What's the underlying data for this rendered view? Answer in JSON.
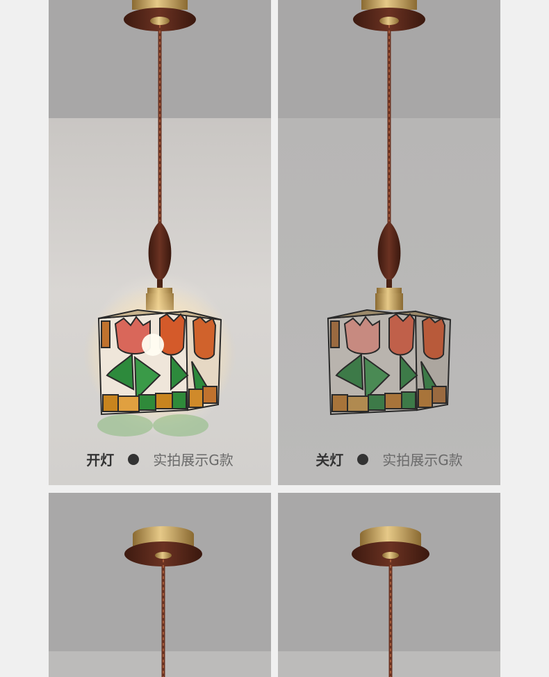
{
  "panels": [
    {
      "state_label": "开灯",
      "product_label": "实拍展示G款"
    },
    {
      "state_label": "关灯",
      "product_label": "实拍展示G款"
    }
  ],
  "icons": [
    "bullet-dot-icon"
  ],
  "colors": {
    "walnut": "#5a2b1c",
    "brass": "#c8a25a",
    "tulip_red": "#c8563c",
    "leaf_green": "#2f8a3a",
    "amber": "#c8841e"
  }
}
